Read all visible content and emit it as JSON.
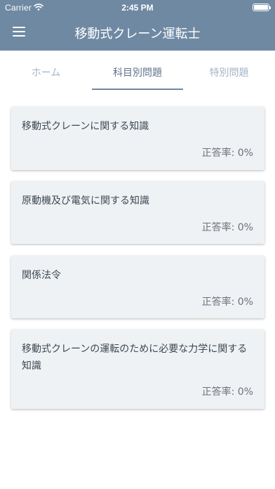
{
  "status_bar": {
    "carrier": "Carrier",
    "time": "2:45 PM"
  },
  "header": {
    "title": "移動式クレーン運転士",
    "menu_icon": "hamburger-menu-icon"
  },
  "tabs": [
    {
      "label": "ホーム",
      "active": false
    },
    {
      "label": "科目別問題",
      "active": true
    },
    {
      "label": "特別問題",
      "active": false
    }
  ],
  "subjects": [
    {
      "title": "移動式クレーンに関する知識",
      "rate": "正答率: 0%"
    },
    {
      "title": "原動機及び電気に関する知識",
      "rate": "正答率: 0%"
    },
    {
      "title": "関係法令",
      "rate": "正答率: 0%"
    },
    {
      "title": "移動式クレーンの運転のために必要な力学に関する知識",
      "rate": "正答率: 0%"
    }
  ],
  "colors": {
    "header_bg": "#6f89a3",
    "card_bg": "#eff2f5",
    "tab_active": "#5f748a",
    "tab_inactive": "#a3b5c7"
  }
}
